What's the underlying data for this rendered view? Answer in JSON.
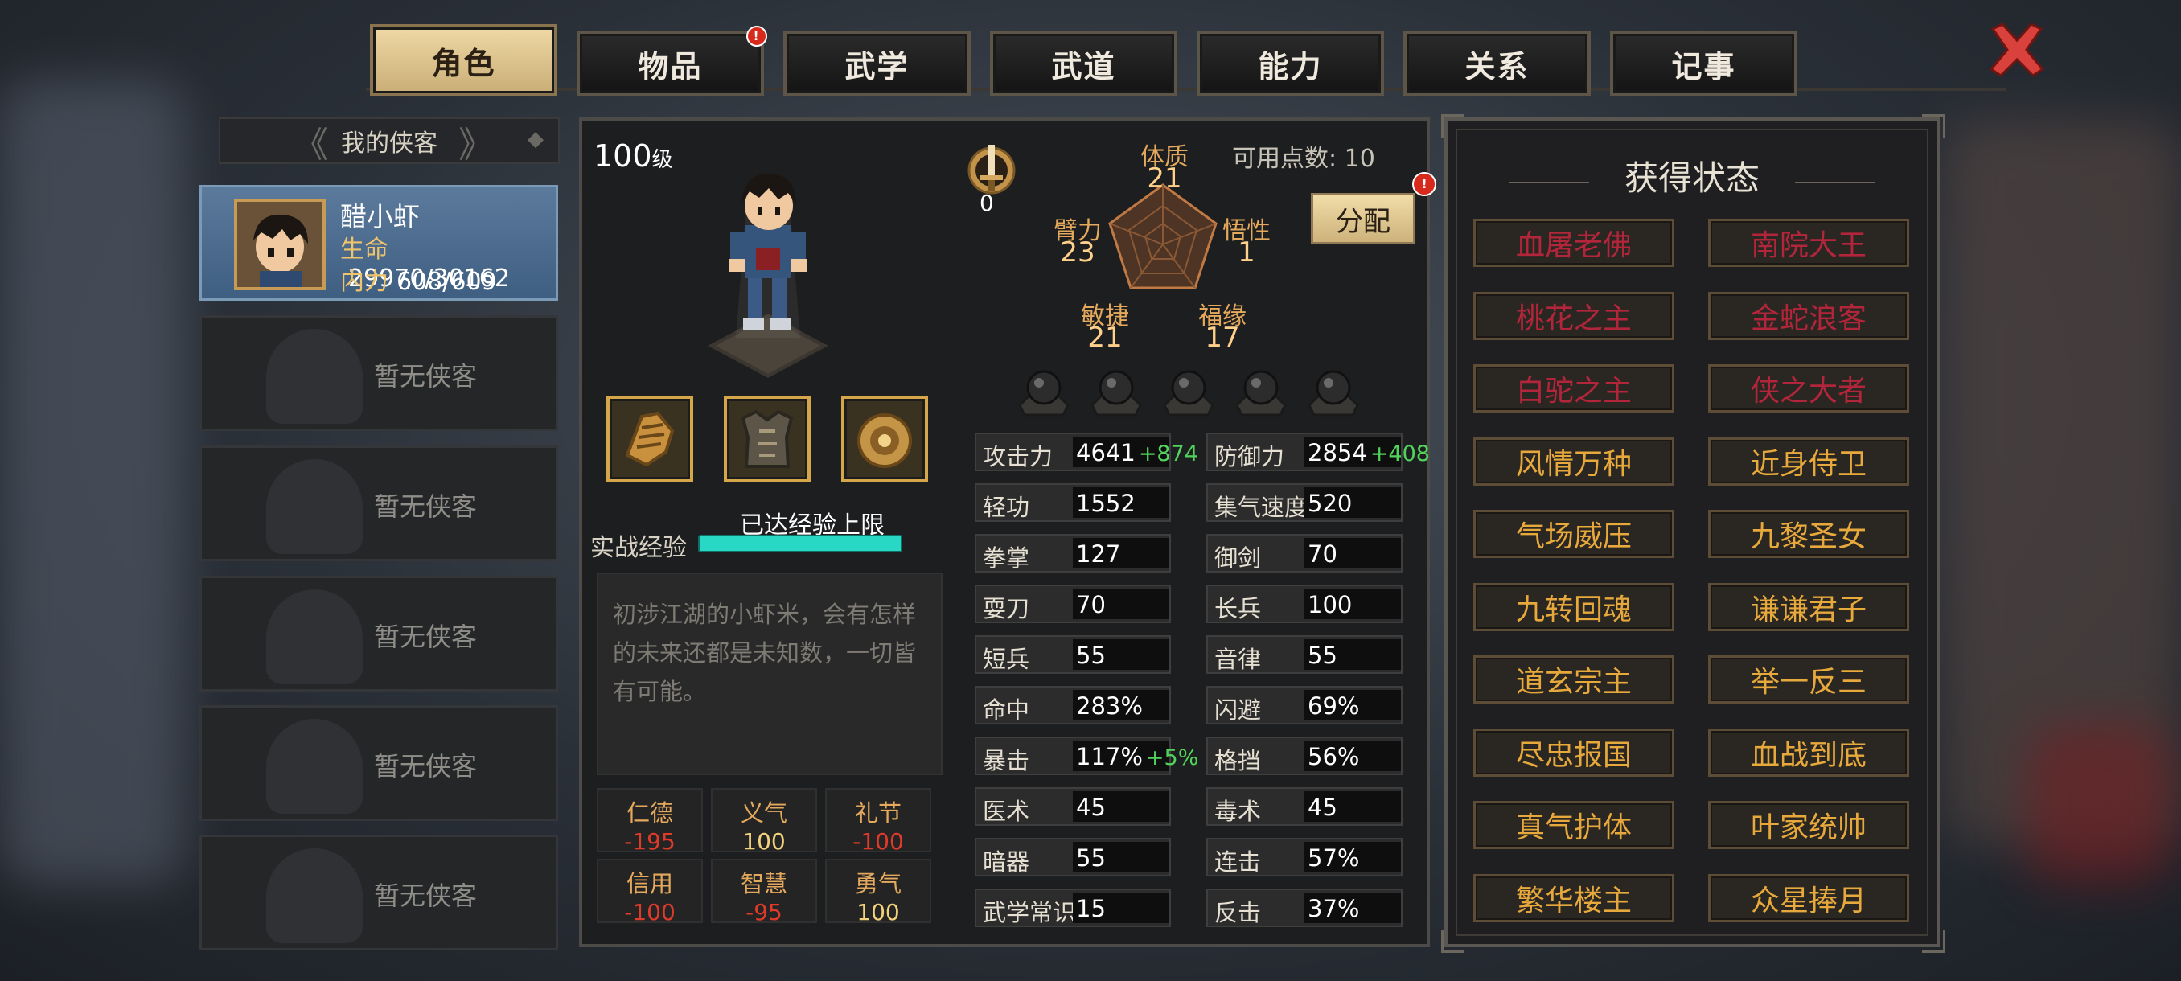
{
  "tabs": [
    {
      "label": "角色",
      "active": true
    },
    {
      "label": "物品",
      "badge": "!"
    },
    {
      "label": "武学"
    },
    {
      "label": "武道"
    },
    {
      "label": "能力"
    },
    {
      "label": "关系"
    },
    {
      "label": "记事"
    }
  ],
  "left": {
    "header": "我的侠客",
    "hero": {
      "name": "醋小虾",
      "hp_label": "生命",
      "hp": "29970/30162",
      "mp_label": "内力",
      "mp": "608/609"
    },
    "empty_label": "暂无侠客"
  },
  "char": {
    "level": "100",
    "level_unit": "级",
    "sword_value": "0",
    "points_label": "可用点数:",
    "points": "10",
    "allocate": "分配",
    "alloc_badge": "!",
    "attributes": [
      {
        "label": "体质",
        "value": "21"
      },
      {
        "label": "悟性",
        "value": "1"
      },
      {
        "label": "福缘",
        "value": "17"
      },
      {
        "label": "敏捷",
        "value": "21"
      },
      {
        "label": "臂力",
        "value": "23"
      }
    ],
    "xp_label": "实战经验",
    "xp_text": "已达经验上限",
    "xp_fraction": 1.0,
    "description": "初涉江湖的小虾米，会有怎样的未来还都是未知数，一切皆有可能。",
    "virtues": [
      {
        "label": "仁德",
        "value": "-195",
        "color": "#e03a2a"
      },
      {
        "label": "义气",
        "value": "100",
        "color": "#f2d27a"
      },
      {
        "label": "礼节",
        "value": "-100",
        "color": "#e03a2a"
      },
      {
        "label": "信用",
        "value": "-100",
        "color": "#e03a2a"
      },
      {
        "label": "智慧",
        "value": "-95",
        "color": "#e03a2a"
      },
      {
        "label": "勇气",
        "value": "100",
        "color": "#f2d27a"
      }
    ]
  },
  "stats_left": [
    {
      "label": "攻击力",
      "value": "4641",
      "bonus": "+874"
    },
    {
      "label": "轻功",
      "value": "1552"
    },
    {
      "label": "拳掌",
      "value": "127"
    },
    {
      "label": "耍刀",
      "value": "70"
    },
    {
      "label": "短兵",
      "value": "55"
    },
    {
      "label": "命中",
      "value": "283%"
    },
    {
      "label": "暴击",
      "value": "117%",
      "bonus": "+5%"
    },
    {
      "label": "医术",
      "value": "45"
    },
    {
      "label": "暗器",
      "value": "55"
    },
    {
      "label": "武学常识",
      "value": "15"
    }
  ],
  "stats_right": [
    {
      "label": "防御力",
      "value": "2854",
      "bonus": "+408"
    },
    {
      "label": "集气速度",
      "value": "520"
    },
    {
      "label": "御剑",
      "value": "70"
    },
    {
      "label": "长兵",
      "value": "100"
    },
    {
      "label": "音律",
      "value": "55"
    },
    {
      "label": "闪避",
      "value": "69%"
    },
    {
      "label": "格挡",
      "value": "56%"
    },
    {
      "label": "毒术",
      "value": "45"
    },
    {
      "label": "连击",
      "value": "57%"
    },
    {
      "label": "反击",
      "value": "37%"
    }
  ],
  "status_panel": {
    "title": "获得状态",
    "items": [
      {
        "label": "血屠老佛",
        "style": "red"
      },
      {
        "label": "南院大王",
        "style": "red"
      },
      {
        "label": "桃花之主",
        "style": "red"
      },
      {
        "label": "金蛇浪客",
        "style": "red"
      },
      {
        "label": "白驼之主",
        "style": "red"
      },
      {
        "label": "侠之大者",
        "style": "red"
      },
      {
        "label": "风情万种",
        "style": "gold"
      },
      {
        "label": "近身侍卫",
        "style": "gold"
      },
      {
        "label": "气场威压",
        "style": "gold"
      },
      {
        "label": "九黎圣女",
        "style": "gold"
      },
      {
        "label": "九转回魂",
        "style": "gold"
      },
      {
        "label": "谦谦君子",
        "style": "gold"
      },
      {
        "label": "道玄宗主",
        "style": "gold"
      },
      {
        "label": "举一反三",
        "style": "gold"
      },
      {
        "label": "尽忠报国",
        "style": "gold"
      },
      {
        "label": "血战到底",
        "style": "gold"
      },
      {
        "label": "真气护体",
        "style": "gold"
      },
      {
        "label": "叶家统帅",
        "style": "gold"
      },
      {
        "label": "繁华楼主",
        "style": "gold"
      },
      {
        "label": "众星捧月",
        "style": "gold"
      }
    ]
  },
  "colors": {
    "accent": "#e7a93b",
    "red": "#b2253a",
    "xp": "#19b8a7",
    "bonus": "#52d45c"
  }
}
